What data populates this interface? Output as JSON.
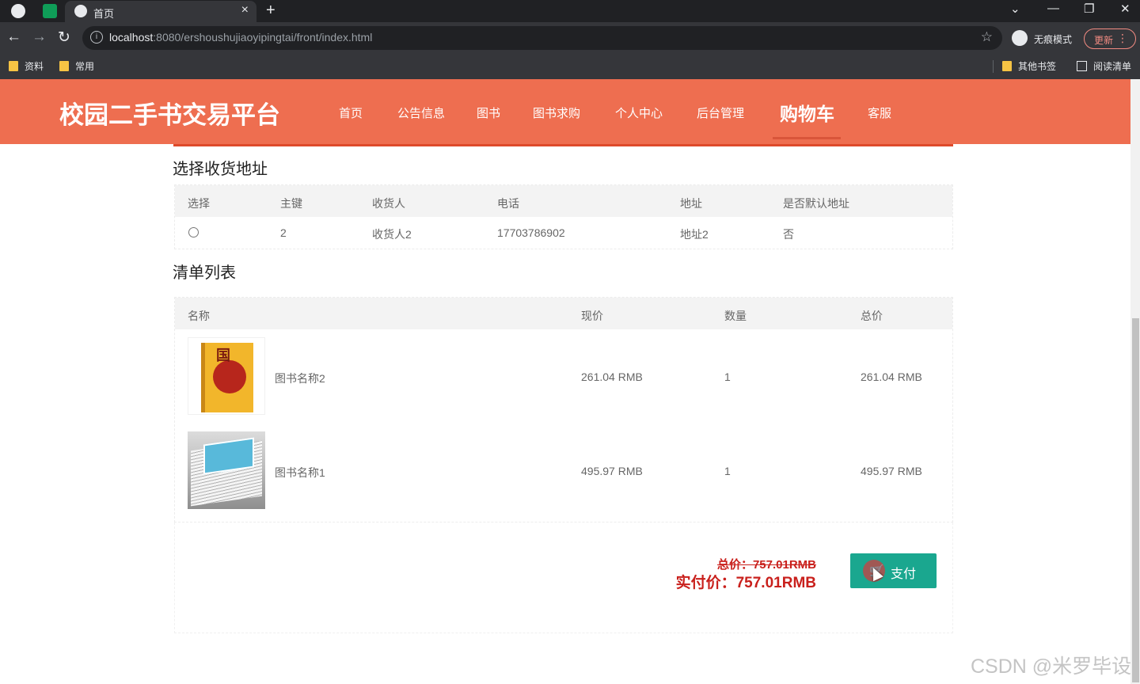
{
  "browser": {
    "tab_title": "首页",
    "url_host": "localhost",
    "url_rest": ":8080/ershoushujiaoyipingtai/front/index.html",
    "incognito_label": "无痕模式",
    "update_label": "更新",
    "bookmarks": [
      "资料",
      "常用"
    ],
    "bookmarks_right": [
      "其他书签",
      "阅读清单"
    ]
  },
  "site": {
    "logo": "校园二手书交易平台",
    "nav": [
      "首页",
      "公告信息",
      "图书",
      "图书求购",
      "个人中心",
      "后台管理",
      "购物车",
      "客服"
    ],
    "active_nav": "购物车",
    "colors": {
      "header": "#ee6e50",
      "pay_button": "#1aa78f",
      "price": "#c9201c"
    }
  },
  "address_section": {
    "title": "选择收货地址",
    "columns": [
      "选择",
      "主键",
      "收货人",
      "电话",
      "地址",
      "是否默认地址"
    ],
    "rows": [
      {
        "selected": false,
        "id": "2",
        "receiver": "收货人2",
        "phone": "17703786902",
        "address": "地址2",
        "is_default": "否"
      }
    ]
  },
  "cart_section": {
    "title": "清单列表",
    "columns": [
      "名称",
      "现价",
      "数量",
      "总价"
    ],
    "rows": [
      {
        "cover_icon": "book-cover-yellow",
        "name": "图书名称2",
        "price": "261.04 RMB",
        "qty": "1",
        "total": "261.04 RMB"
      },
      {
        "cover_icon": "book-cover-stack",
        "name": "图书名称1",
        "price": "495.97 RMB",
        "qty": "1",
        "total": "495.97 RMB"
      }
    ]
  },
  "summary": {
    "original_total": "总价：757.01RMB",
    "actual_total": "实付价：757.01RMB",
    "pay_label": "支付"
  },
  "watermark": "CSDN @米罗毕设"
}
